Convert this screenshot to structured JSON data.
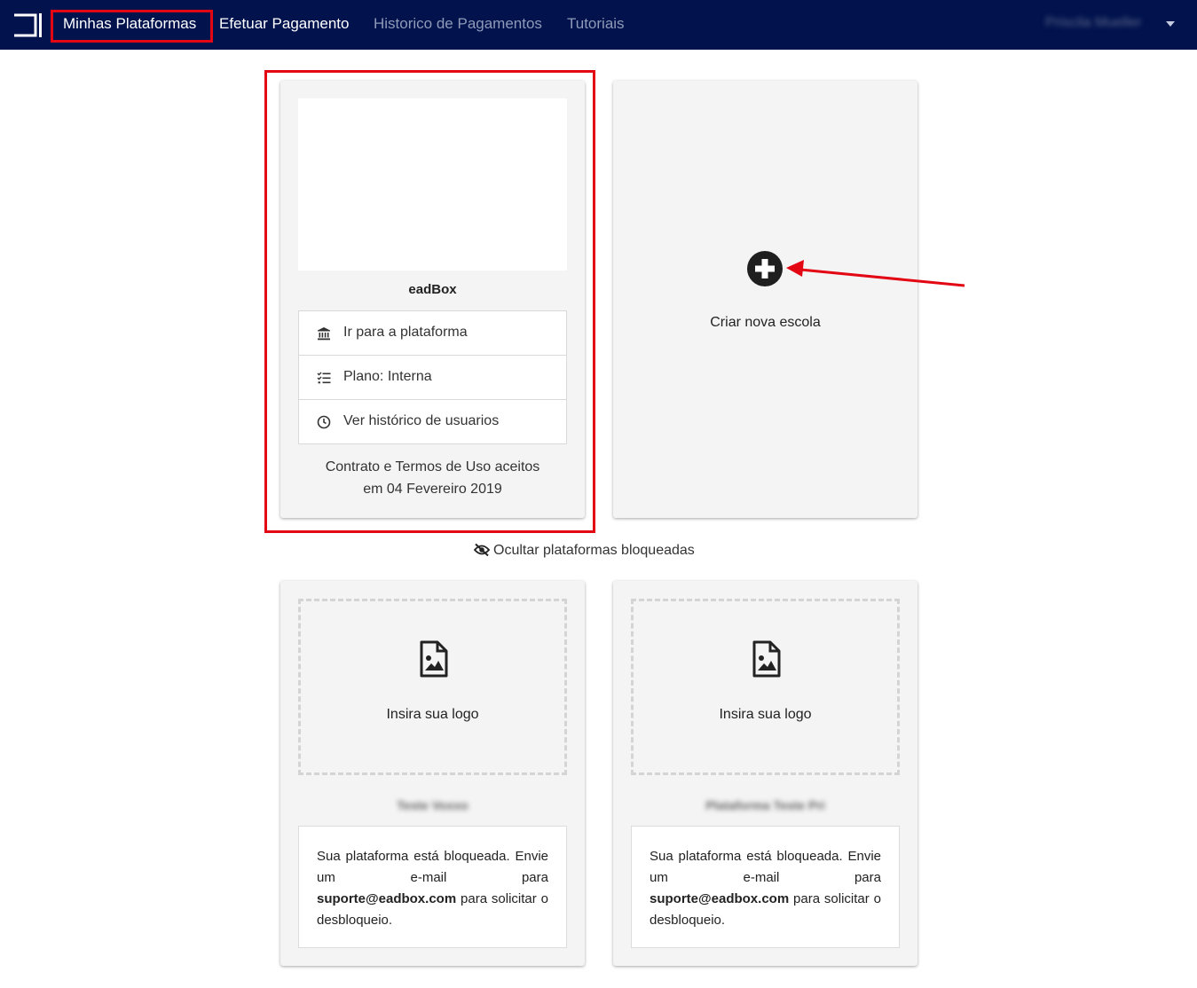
{
  "navbar": {
    "links": [
      {
        "label": "Minhas Plataformas",
        "active": true
      },
      {
        "label": "Efetuar Pagamento",
        "active": false
      },
      {
        "label": "Historico de Pagamentos",
        "active": false
      },
      {
        "label": "Tutoriais",
        "active": false
      }
    ],
    "user_name": "Priscila Mueller",
    "bg_color": "#01124d"
  },
  "platforms": [
    {
      "name": "eadBox",
      "actions": [
        {
          "icon": "bank-icon",
          "label": "Ir para a plataforma"
        },
        {
          "icon": "checklist-icon",
          "label": "Plano: Interna"
        },
        {
          "icon": "clock-icon",
          "label": "Ver histórico de usuarios"
        }
      ],
      "contract_line1": "Contrato e Termos de Uso aceitos",
      "contract_line2": "em 04 Fevereiro 2019"
    }
  ],
  "create_school": {
    "label": "Criar nova escola"
  },
  "hide_blocked": {
    "label": "Ocultar plataformas bloqueadas"
  },
  "blocked_platforms": [
    {
      "name": "Teste Voxxo",
      "logo_placeholder": "Insira sua logo",
      "message_start": "Sua plataforma está bloqueada. Envie um e-mail para ",
      "email": "suporte@eadbox.com",
      "message_end": " para solicitar o desbloqueio."
    },
    {
      "name": "Plataforma Teste Pri",
      "logo_placeholder": "Insira sua logo",
      "message_start": "Sua plataforma está bloqueada. Envie um e-mail para ",
      "email": "suporte@eadbox.com",
      "message_end": " para solicitar o desbloqueio."
    }
  ],
  "annotation_color": "#e30613"
}
